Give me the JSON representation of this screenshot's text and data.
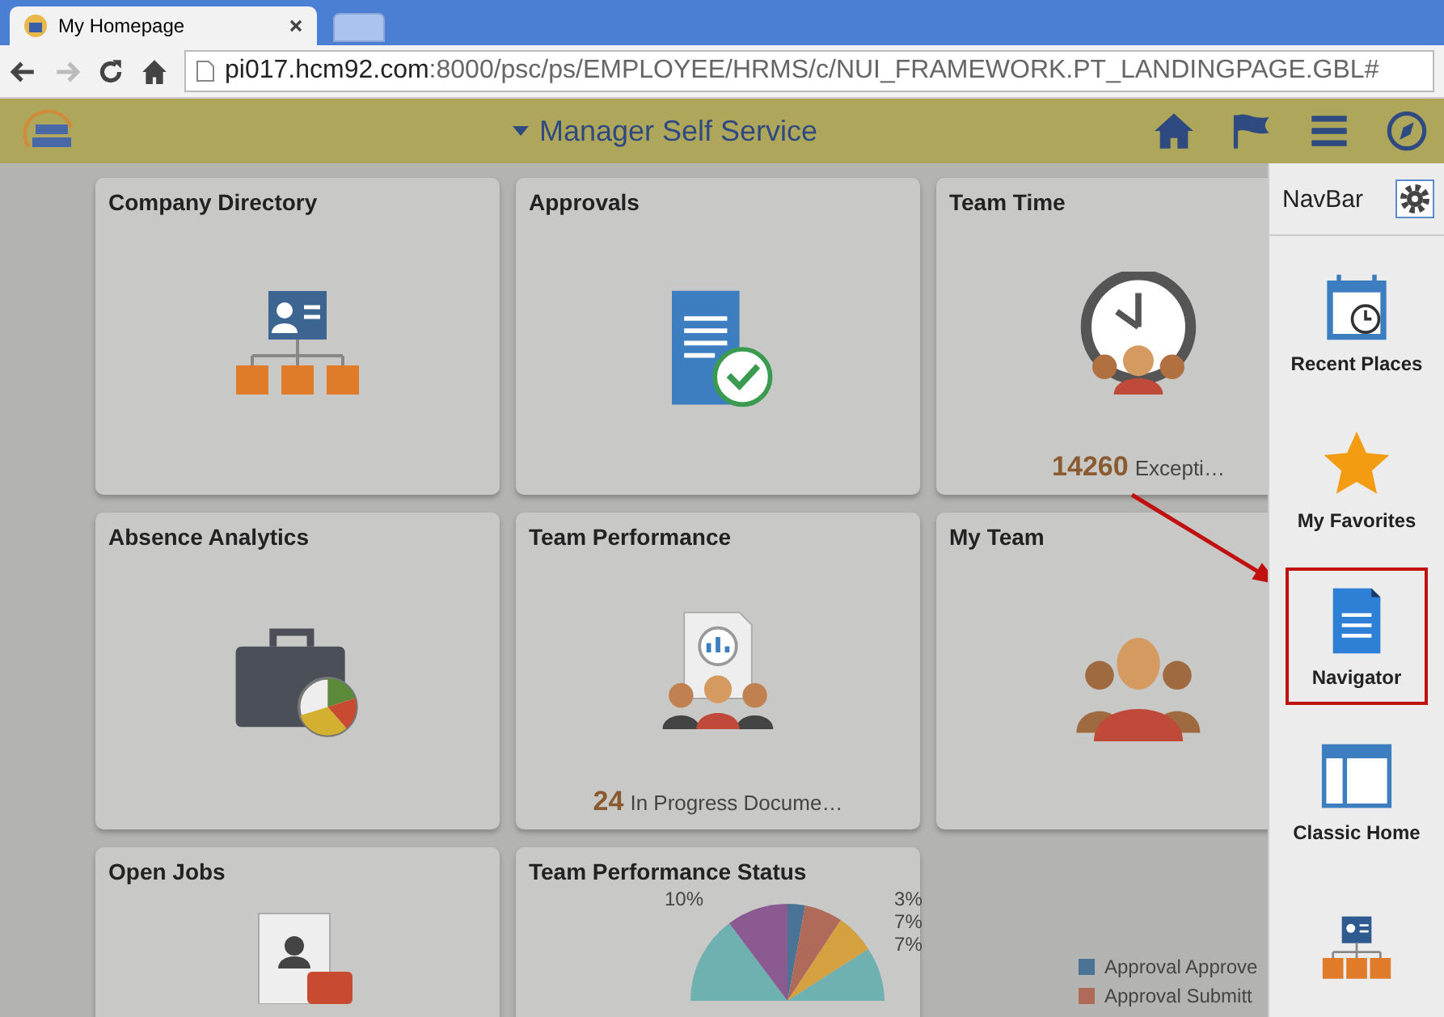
{
  "browser": {
    "tab_title": "My Homepage",
    "url_host": "pi017.hcm92.com",
    "url_path": ":8000/psc/ps/EMPLOYEE/HRMS/c/NUI_FRAMEWORK.PT_LANDINGPAGE.GBL#"
  },
  "header": {
    "title": "Manager Self Service"
  },
  "tiles": [
    {
      "title": "Company Directory",
      "kind": "directory"
    },
    {
      "title": "Approvals",
      "kind": "approvals"
    },
    {
      "title": "Team Time",
      "kind": "clock",
      "count": "14260",
      "caption": "Excepti…"
    },
    {
      "title": "Absence Analytics",
      "kind": "briefcase"
    },
    {
      "title": "Team Performance",
      "kind": "performance",
      "count": "24",
      "caption": "In Progress Docume…"
    },
    {
      "title": "My Team",
      "kind": "team"
    },
    {
      "title": "Open Jobs",
      "kind": "jobs"
    },
    {
      "title": "Team Performance Status",
      "kind": "pie",
      "pie_labels": [
        "10%",
        "3%",
        "7%",
        "7%"
      ],
      "legend": [
        {
          "label": "Approval Approve",
          "color": "#4a7396"
        },
        {
          "label": "Approval Submitt",
          "color": "#b06a5a"
        }
      ]
    }
  ],
  "navbar": {
    "title": "NavBar",
    "items": [
      {
        "label": "Recent Places",
        "kind": "calendar",
        "highlighted": false
      },
      {
        "label": "My Favorites",
        "kind": "star",
        "highlighted": false
      },
      {
        "label": "Navigator",
        "kind": "document",
        "highlighted": true
      },
      {
        "label": "Classic Home",
        "kind": "window",
        "highlighted": false
      },
      {
        "kind": "orgchart",
        "highlighted": false
      }
    ]
  }
}
